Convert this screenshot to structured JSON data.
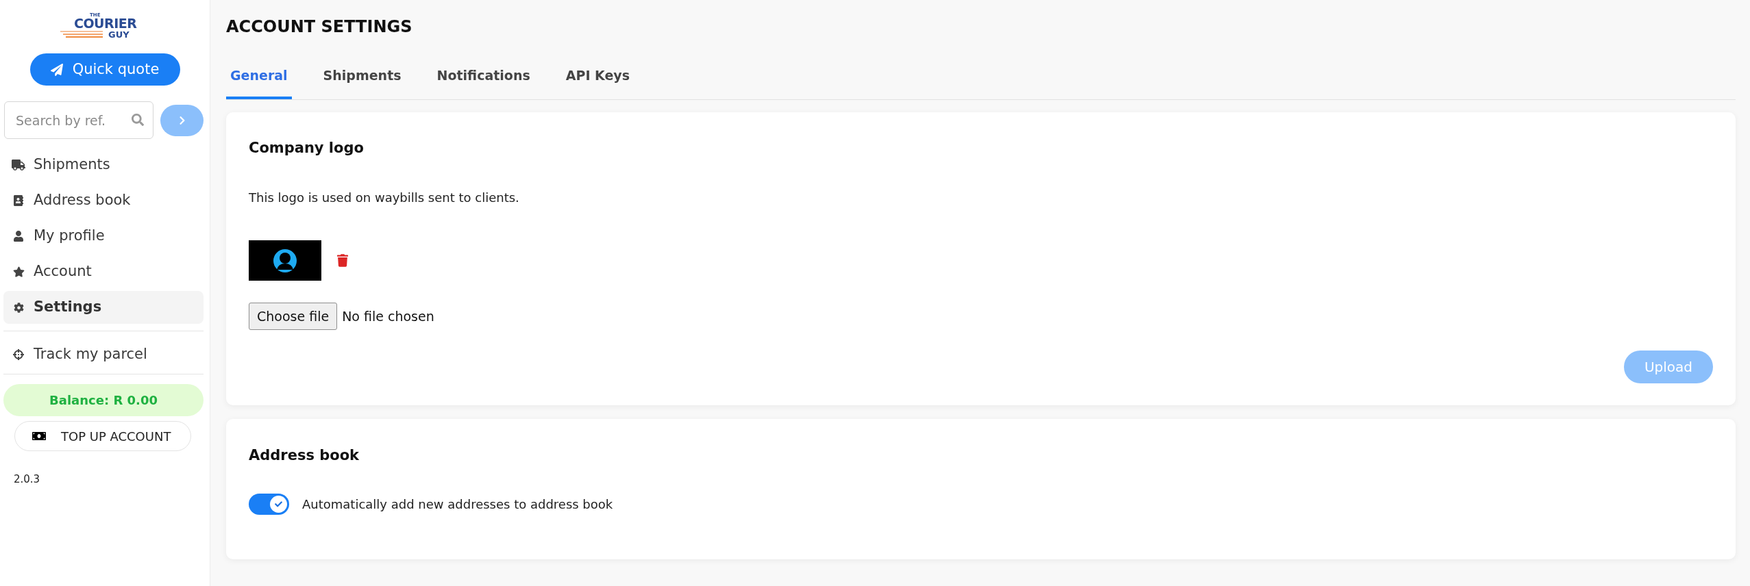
{
  "sidebar": {
    "logo": {
      "top": "THE",
      "main": "COURIER",
      "bottom": "GUY"
    },
    "quick_quote": "Quick quote",
    "search": {
      "placeholder": "Search by ref.",
      "submit_disabled": true
    },
    "nav_items": [
      {
        "label": "Shipments",
        "selected": false
      },
      {
        "label": "Address book",
        "selected": false
      },
      {
        "label": "My profile",
        "selected": false
      },
      {
        "label": "Account",
        "selected": false
      },
      {
        "label": "Settings",
        "selected": true
      }
    ],
    "links": [
      {
        "label": "Track my parcel",
        "selected": false
      }
    ],
    "balance": "Balance: R 0.00",
    "top_up": "TOP UP ACCOUNT",
    "version": "2.0.3"
  },
  "page": {
    "title": "ACCOUNT SETTINGS",
    "tabs": [
      {
        "label": "General",
        "selected": true
      },
      {
        "label": "Shipments",
        "selected": false
      },
      {
        "label": "Notifications",
        "selected": false
      },
      {
        "label": "API Keys",
        "selected": false
      }
    ]
  },
  "company_logo": {
    "title": "Company logo",
    "description": "This logo is used on waybills sent to clients.",
    "file_input": {
      "button": "Choose file",
      "status": "No file chosen"
    },
    "upload": {
      "label": "Upload",
      "disabled": true
    }
  },
  "address_book": {
    "title": "Address book",
    "toggle": {
      "label": "Automatically add new addresses to address book",
      "on": true
    }
  }
}
